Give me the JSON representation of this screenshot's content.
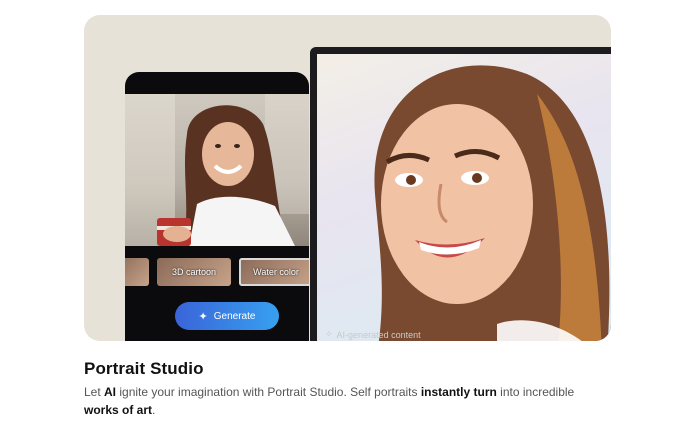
{
  "hero": {
    "filters": [
      {
        "label": ""
      },
      {
        "label": "3D cartoon"
      },
      {
        "label": "Water color",
        "selected": true
      }
    ],
    "generate_label": "Generate",
    "watermark": "AI-generated content",
    "colors": {
      "accent_start": "#3a64d8",
      "accent_end": "#37a0f0",
      "background": "#e7e2d8"
    }
  },
  "feature": {
    "title": "Portrait Studio",
    "description": {
      "p1": "Let ",
      "b1": "AI",
      "p2": " ignite your imagination with Portrait Studio. Self portraits ",
      "b2": "instantly turn",
      "p3": " into incredible ",
      "b3": "works of art",
      "p4": "."
    }
  }
}
